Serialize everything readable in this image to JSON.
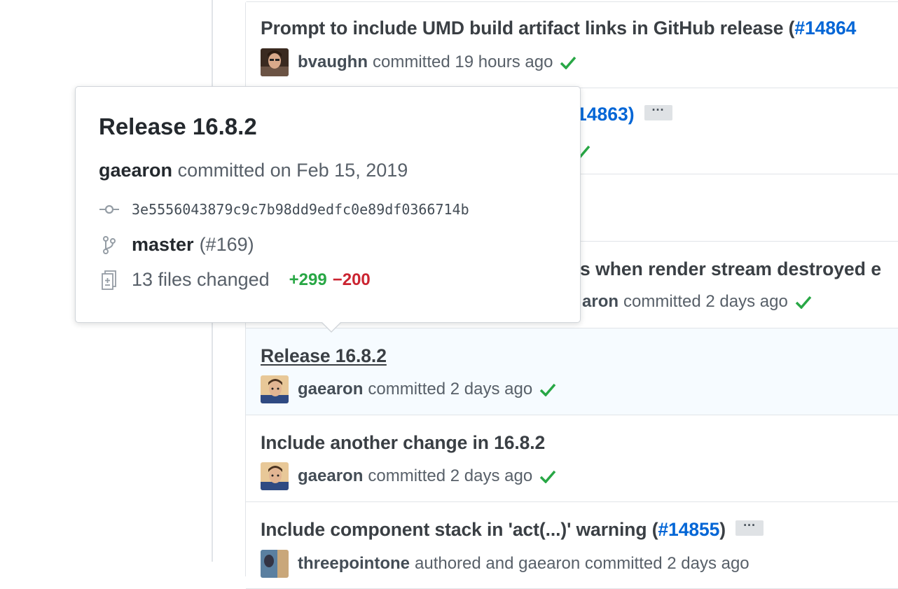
{
  "commits": [
    {
      "title": "Prompt to include UMD build artifact links in GitHub release (",
      "pr": "#14864",
      "author": "bvaughn",
      "action": "committed 19 hours ago"
    },
    {
      "pr_fragment": "14863)",
      "ellipsis": "···"
    },
    {},
    {
      "title_fragment": "s when render stream destroyed e",
      "author_fragment": "aron",
      "action": "committed 2 days ago"
    },
    {
      "title": "Release 16.8.2",
      "author": "gaearon",
      "action": "committed 2 days ago"
    },
    {
      "title": "Include another change in 16.8.2",
      "author": "gaearon",
      "action": "committed 2 days ago"
    },
    {
      "title": "Include component stack in 'act(...)' warning (",
      "pr": "#14855",
      "title_end": ")",
      "ellipsis": "···",
      "author": "threepointone",
      "action": "authored and gaearon committed 2 days ago"
    }
  ],
  "hovercard": {
    "title": "Release 16.8.2",
    "committer": "gaearon",
    "committed_on": "committed on Feb 15, 2019",
    "sha": "3e5556043879c9c7b98dd9edfc0e89df0366714b",
    "branch": "master",
    "branch_pr": "(#169)",
    "files_changed": "13 files changed",
    "additions": "+299",
    "deletions": "−200"
  },
  "colors": {
    "link": "#0366d6",
    "success": "#28a745",
    "danger": "#cb2431",
    "border": "#e1e4e8"
  }
}
